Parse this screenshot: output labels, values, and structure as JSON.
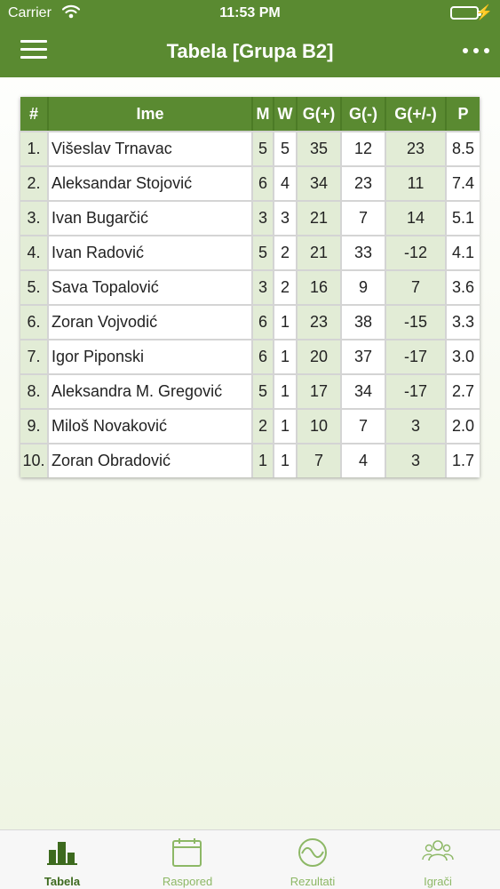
{
  "status_bar": {
    "carrier": "Carrier",
    "time": "11:53 PM"
  },
  "header": {
    "title": "Tabela [Grupa B2]",
    "menu_icon": "hamburger-menu-icon",
    "more_icon": "more-dots-icon"
  },
  "colors": {
    "brand_green": "#5a8a31",
    "light_green": "#e2ecd6",
    "tab_inactive": "#8db866",
    "battery": "#4cd964"
  },
  "table": {
    "columns": [
      "#",
      "Ime",
      "M",
      "W",
      "G(+)",
      "G(-)",
      "G(+/-)",
      "P"
    ],
    "rows": [
      [
        "1.",
        "Višeslav Trnavac",
        "5",
        "5",
        "35",
        "12",
        "23",
        "8.5"
      ],
      [
        "2.",
        "Aleksandar Stojović",
        "6",
        "4",
        "34",
        "23",
        "11",
        "7.4"
      ],
      [
        "3.",
        "Ivan Bugarčić",
        "3",
        "3",
        "21",
        "7",
        "14",
        "5.1"
      ],
      [
        "4.",
        "Ivan Radović",
        "5",
        "2",
        "21",
        "33",
        "-12",
        "4.1"
      ],
      [
        "5.",
        "Sava Topalović",
        "3",
        "2",
        "16",
        "9",
        "7",
        "3.6"
      ],
      [
        "6.",
        "Zoran Vojvodić",
        "6",
        "1",
        "23",
        "38",
        "-15",
        "3.3"
      ],
      [
        "7.",
        "Igor Piponski",
        "6",
        "1",
        "20",
        "37",
        "-17",
        "3.0"
      ],
      [
        "8.",
        "Aleksandra M. Gregović",
        "5",
        "1",
        "17",
        "34",
        "-17",
        "2.7"
      ],
      [
        "9.",
        "Miloš Novaković",
        "2",
        "1",
        "10",
        "7",
        "3",
        "2.0"
      ],
      [
        "10.",
        "Zoran Obradović",
        "1",
        "1",
        "7",
        "4",
        "3",
        "1.7"
      ]
    ]
  },
  "tabs": [
    {
      "label": "Tabela",
      "icon": "bar-chart-icon",
      "active": true
    },
    {
      "label": "Raspored",
      "icon": "calendar-icon",
      "active": false
    },
    {
      "label": "Rezultati",
      "icon": "scores-icon",
      "active": false
    },
    {
      "label": "Igrači",
      "icon": "players-icon",
      "active": false
    }
  ]
}
